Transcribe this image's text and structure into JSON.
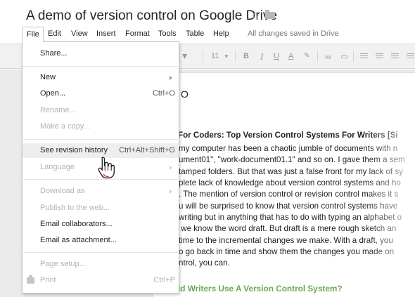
{
  "window": {
    "title": "A demo of version control on Google Drive"
  },
  "menubar": {
    "items": [
      {
        "label": "File"
      },
      {
        "label": "Edit"
      },
      {
        "label": "View"
      },
      {
        "label": "Insert"
      },
      {
        "label": "Format"
      },
      {
        "label": "Tools"
      },
      {
        "label": "Table"
      },
      {
        "label": "Help"
      }
    ],
    "status": "All changes saved in Drive"
  },
  "toolbar": {
    "font_size": "11"
  },
  "file_menu": {
    "items": [
      {
        "label": "Share...",
        "shortcut": "",
        "disabled": false
      },
      {
        "label": "New",
        "shortcut": "",
        "disabled": false,
        "submenu": true
      },
      {
        "label": "Open...",
        "shortcut": "Ctrl+O",
        "disabled": false
      },
      {
        "label": "Rename...",
        "shortcut": "",
        "disabled": true
      },
      {
        "label": "Make a copy...",
        "shortcut": "",
        "disabled": true
      },
      {
        "label": "See revision history",
        "shortcut": "Ctrl+Alt+Shift+G",
        "disabled": false,
        "highlighted": true
      },
      {
        "label": "Language",
        "shortcut": "",
        "disabled": true,
        "submenu": true
      },
      {
        "label": "Download as",
        "shortcut": "",
        "disabled": true,
        "submenu": true
      },
      {
        "label": "Publish to the web...",
        "shortcut": "",
        "disabled": true
      },
      {
        "label": "Email collaborators...",
        "shortcut": "",
        "disabled": false
      },
      {
        "label": "Email as attachment...",
        "shortcut": "",
        "disabled": false
      },
      {
        "label": "Page setup...",
        "shortcut": "",
        "disabled": true
      },
      {
        "label": "Print",
        "shortcut": "Ctrl+P",
        "disabled": true
      }
    ]
  },
  "document": {
    "heading_letter": "O",
    "heading": "For Coders: Top Version Control Systems For Writers [Si",
    "lines": [
      "my computer has been a chaotic jumble of documents with n",
      "ument01\", \"work-document01.1\" and so on. I gave them a sem",
      "tamped folders. But that was just a false front for my lack of sy",
      "plete lack of knowledge about version control systems and ho",
      ". The mention of version control or revision control makes it s",
      "u will be surprised to know that version control systems have",
      "writing but in anything that has to do with typing an alphabet o",
      " we know the word draft. But draft is a mere rough sketch an",
      "time to the incremental changes we make. With a draft, you",
      "o go back in time and show them the changes you made on",
      "ntrol, you can."
    ],
    "subheading": "ld Writers Use A Version Control System?"
  },
  "colors": {
    "menu_highlight": "#eeeeee",
    "subheading_green": "#6aa84f",
    "disabled_text": "#b2b2b2"
  }
}
